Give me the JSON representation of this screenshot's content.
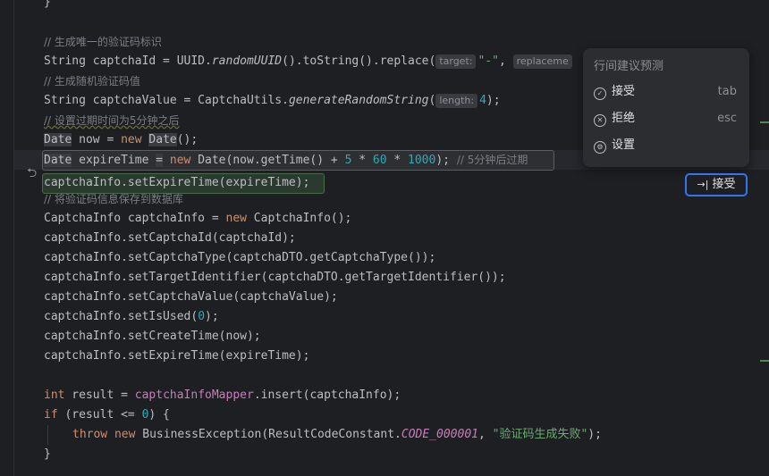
{
  "code": {
    "brace_top": "}",
    "c1": "// 生成唯一的验证码标识",
    "l1_a": "String captchaId = UUID.",
    "l1_m": "randomUUID",
    "l1_b": "().toString().replace(",
    "l1_hint1": "target:",
    "l1_s1": "\"-\"",
    "l1_c": ", ",
    "l1_hint2": "replaceme",
    "c2": "// 生成随机验证码值",
    "l2_a": "String captchaValue = CaptchaUtils.",
    "l2_m": "generateRandomString",
    "l2_b": "(",
    "l2_hint": "length:",
    "l2_n": "4",
    "l2_c": ");",
    "c3": "// 设置过期时间为5分钟之后",
    "l3_t1": "Date",
    "l3_a": " now = ",
    "l3_new": "new",
    "l3_t2": "Date",
    "l3_b": "();",
    "l4_t": "Date",
    "l4_a": " expireTime ",
    "l4_eq": "=",
    "l4_sp": " ",
    "l4_new": "new",
    "l4_b": " Date(now.getTime() + ",
    "l4_n1": "5",
    "l4_m1": " * ",
    "l4_n2": "60",
    "l4_m2": " * ",
    "l4_n3": "1000",
    "l4_c": "); ",
    "l4_cm": "// 5分钟后过期",
    "l5": "captchaInfo.setExpireTime(expireTime);",
    "c4": "// 将验证码信息保存到数据库",
    "l6_a": "CaptchaInfo captchaInfo = ",
    "l6_new": "new",
    "l6_b": " CaptchaInfo();",
    "l7": "captchaInfo.setCaptchaId(captchaId);",
    "l8": "captchaInfo.setCaptchaType(captchaDTO.getCaptchaType());",
    "l9": "captchaInfo.setTargetIdentifier(captchaDTO.getTargetIdentifier());",
    "l10": "captchaInfo.setCaptchaValue(captchaValue);",
    "l11_a": "captchaInfo.setIsUsed(",
    "l11_n": "0",
    "l11_b": ");",
    "l12": "captchaInfo.setCreateTime(now);",
    "l13": "captchaInfo.setExpireTime(expireTime);",
    "l14_int": "int",
    "l14_a": " result = ",
    "l14_f": "captchaInfoMapper",
    "l14_b": ".insert(captchaInfo);",
    "l15_if": "if",
    "l15_a": " (result <= ",
    "l15_n": "0",
    "l15_b": ") {",
    "l16_throw": "throw",
    "l16_new": "new",
    "l16_a": " BusinessException(ResultCodeConstant.",
    "l16_c": "CODE_000001",
    "l16_b": ", ",
    "l16_s": "\"验证码生成失败\"",
    "l16_e": ");",
    "brace_bottom": "}"
  },
  "popup": {
    "title": "行间建议预测",
    "items": [
      {
        "label": "接受",
        "shortcut": "tab"
      },
      {
        "label": "拒绝",
        "shortcut": "esc"
      },
      {
        "label": "设置",
        "shortcut": ""
      }
    ]
  },
  "accept_button": {
    "icon": "→|",
    "label": "接受"
  },
  "colors": {
    "accent": "#3574f0",
    "background": "#1e1f22"
  }
}
